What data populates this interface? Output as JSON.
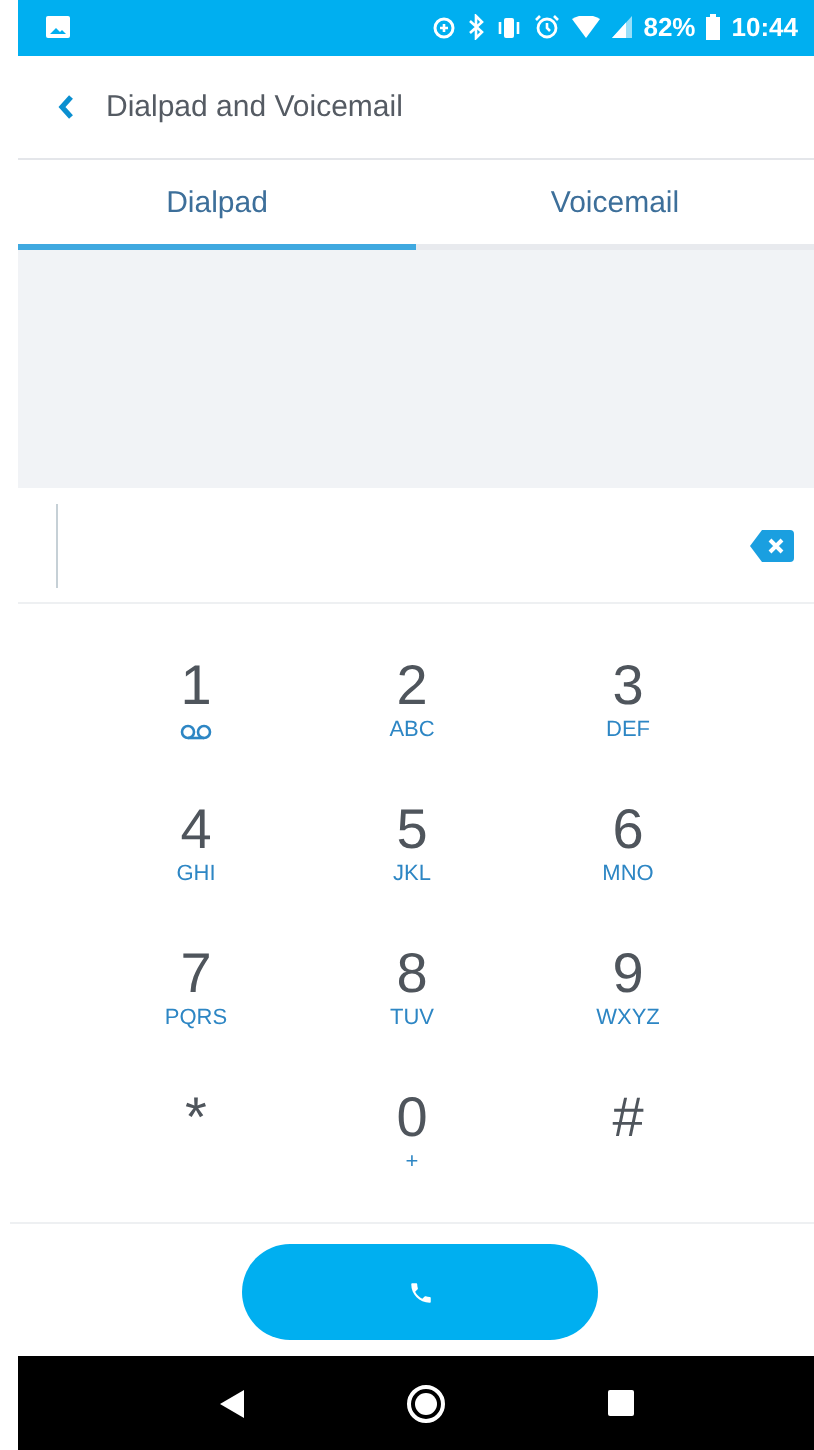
{
  "status_bar": {
    "battery": "82%",
    "time": "10:44"
  },
  "header": {
    "title": "Dialpad and Voicemail"
  },
  "tabs": [
    {
      "label": "Dialpad",
      "selected": true
    },
    {
      "label": "Voicemail",
      "selected": false
    }
  ],
  "keys": [
    {
      "digit": "1",
      "kind": "voicemail"
    },
    {
      "digit": "2",
      "kind": "letters",
      "letters": "ABC"
    },
    {
      "digit": "3",
      "kind": "letters",
      "letters": "DEF"
    },
    {
      "digit": "4",
      "kind": "letters",
      "letters": "GHI"
    },
    {
      "digit": "5",
      "kind": "letters",
      "letters": "JKL"
    },
    {
      "digit": "6",
      "kind": "letters",
      "letters": "MNO"
    },
    {
      "digit": "7",
      "kind": "letters",
      "letters": "PQRS"
    },
    {
      "digit": "8",
      "kind": "letters",
      "letters": "TUV"
    },
    {
      "digit": "9",
      "kind": "letters",
      "letters": "WXYZ"
    },
    {
      "digit": "*",
      "kind": "plain"
    },
    {
      "digit": "0",
      "kind": "letters",
      "letters": "+"
    },
    {
      "digit": "#",
      "kind": "plain"
    }
  ]
}
